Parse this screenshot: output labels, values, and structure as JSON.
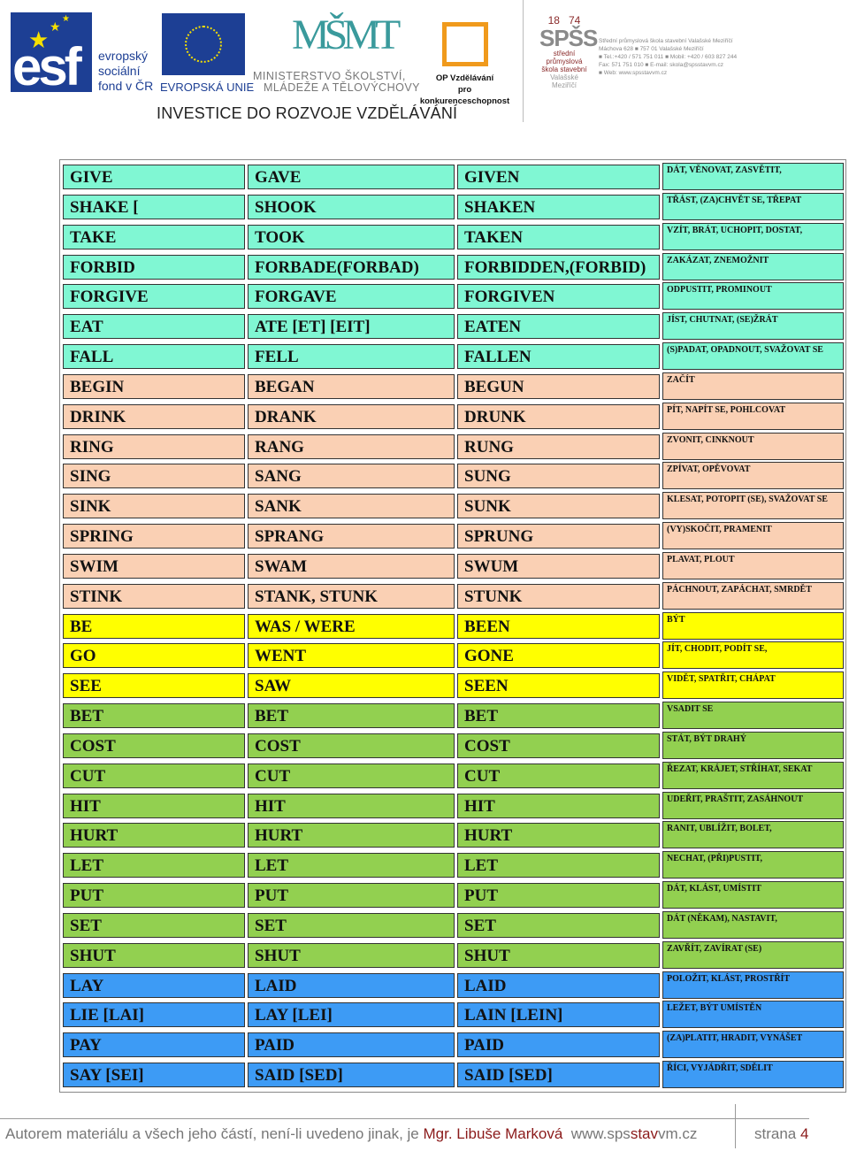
{
  "header": {
    "esf_logo": "esf",
    "esf_label": [
      "evropský",
      "sociální",
      "fond v ČR"
    ],
    "eu_label": "EVROPSKÁ UNIE",
    "msmt_logo": "MŠMT",
    "msmt_label": [
      "MINISTERSTVO ŠKOLSTVÍ,",
      "MLÁDEŽE A TĚLOVÝCHOVY"
    ],
    "op_label": [
      "OP Vzdělávání",
      "pro konkurenceschopnost"
    ],
    "school_logo": {
      "year_left": "18",
      "year_right": "74",
      "abbr": "SPŠS",
      "lines": [
        "střední průmyslová",
        "škola stavební",
        "Valašské Meziříčí"
      ]
    },
    "school_info": [
      "Střední průmyslová škola stavební Valašské Meziříčí",
      "Máchova 628 ■ 757 01 Valašské Meziříčí",
      "■ Tel.:+420 / 571 751 011 ■ Mobil: +420 / 603 827 244",
      "Fax: 571 751 010 ■ E-mail: skola@spsstavvm.cz",
      "■ Web: www.spsstavvm.cz"
    ],
    "slogan": "INVESTICE DO ROZVOJE VZDĚLÁVÁNÍ"
  },
  "colors": {
    "mint": "#80f7d3",
    "peach": "#fad0b4",
    "yellow": "#ffff00",
    "green": "#92d050",
    "blue": "#3d9bf5"
  },
  "rows": [
    {
      "group": "mint",
      "cols": [
        "GIVE",
        "GAVE",
        "GIVEN",
        "DÁT, VĚNOVAT, ZASVĚTIT,"
      ]
    },
    {
      "group": "mint",
      "cols": [
        "SHAKE [",
        "SHOOK",
        "SHAKEN",
        "TŘÁST, (ZA)CHVĚT SE, TŘEPAT"
      ]
    },
    {
      "group": "mint",
      "cols": [
        "TAKE",
        "TOOK",
        "TAKEN",
        "VZÍT, BRÁT, UCHOPIT, DOSTAT,"
      ]
    },
    {
      "group": "mint",
      "cols": [
        "FORBID",
        "FORBADE(FORBAD)",
        "FORBIDDEN,(FORBID)",
        "ZAKÁZAT, ZNEMOŽNIT"
      ]
    },
    {
      "group": "mint",
      "cols": [
        "FORGIVE",
        "FORGAVE",
        "FORGIVEN",
        "ODPUSTIT, PROMINOUT"
      ]
    },
    {
      "group": "mint",
      "cols": [
        "EAT",
        "ATE [ET] [EIT]",
        "EATEN",
        "JÍST, CHUTNAT, (SE)ŽRÁT"
      ]
    },
    {
      "group": "mint",
      "cols": [
        "FALL",
        "FELL",
        "FALLEN",
        "(S)PADAT, OPADNOUT, SVAŽOVAT SE"
      ]
    },
    {
      "group": "peach",
      "cols": [
        "BEGIN",
        "BEGAN",
        "BEGUN",
        "ZAČÍT"
      ]
    },
    {
      "group": "peach",
      "cols": [
        "DRINK",
        "DRANK",
        "DRUNK",
        "PÍT, NAPÍT SE, POHLCOVAT"
      ]
    },
    {
      "group": "peach",
      "cols": [
        "RING",
        "RANG",
        "RUNG",
        "ZVONIT, CINKNOUT"
      ]
    },
    {
      "group": "peach",
      "cols": [
        "SING",
        "SANG",
        "SUNG",
        "ZPÍVAT, OPĚVOVAT"
      ]
    },
    {
      "group": "peach",
      "cols": [
        "SINK",
        "SANK",
        "SUNK",
        "KLESAT, POTOPIT (SE), SVAŽOVAT SE"
      ]
    },
    {
      "group": "peach",
      "cols": [
        "SPRING",
        "SPRANG",
        "SPRUNG",
        "(VY)SKOČIT, PRAMENIT"
      ]
    },
    {
      "group": "peach",
      "cols": [
        "SWIM",
        "SWAM",
        "SWUM",
        "PLAVAT, PLOUT"
      ]
    },
    {
      "group": "peach",
      "cols": [
        "STINK",
        "STANK, STUNK",
        "STUNK",
        "PÁCHNOUT, ZAPÁCHAT, SMRDĚT"
      ]
    },
    {
      "group": "yellow",
      "cols": [
        "BE",
        "WAS / WERE",
        "BEEN",
        "BÝT"
      ]
    },
    {
      "group": "yellow",
      "cols": [
        "GO",
        "WENT",
        "GONE",
        "JÍT, CHODIT, PODÍT SE,"
      ]
    },
    {
      "group": "yellow",
      "cols": [
        "SEE",
        "SAW",
        "SEEN",
        "VIDĚT, SPATŘIT, CHÁPAT"
      ]
    },
    {
      "group": "green",
      "cols": [
        "BET",
        "BET",
        "BET",
        "VSADIT SE"
      ]
    },
    {
      "group": "green",
      "cols": [
        "COST",
        "COST",
        "COST",
        "STÁT, BÝT DRAHÝ"
      ]
    },
    {
      "group": "green",
      "cols": [
        "CUT",
        "CUT",
        "CUT",
        "ŘEZAT, KRÁJET, STŘÍHAT, SEKAT"
      ]
    },
    {
      "group": "green",
      "cols": [
        "HIT",
        "HIT",
        "HIT",
        "UDEŘIT, PRAŠTIT, ZASÁHNOUT"
      ]
    },
    {
      "group": "green",
      "cols": [
        "HURT",
        "HURT",
        "HURT",
        "RANIT, UBLÍŽIT, BOLET,"
      ]
    },
    {
      "group": "green",
      "cols": [
        "LET",
        "LET",
        "LET",
        "NECHAT, (PŘI)PUSTIT,"
      ]
    },
    {
      "group": "green",
      "cols": [
        "PUT",
        "PUT",
        "PUT",
        "DÁT, KLÁST, UMÍSTIT"
      ]
    },
    {
      "group": "green",
      "cols": [
        "SET",
        "SET",
        "SET",
        "DÁT (NĚKAM), NASTAVIT,"
      ]
    },
    {
      "group": "green",
      "cols": [
        "SHUT",
        "SHUT",
        "SHUT",
        "ZAVŘÍT, ZAVÍRAT (SE)"
      ]
    },
    {
      "group": "blue",
      "cols": [
        "LAY",
        "LAID",
        "LAID",
        "POLOŽIT, KLÁST, PROSTŘÍT"
      ]
    },
    {
      "group": "blue",
      "cols": [
        "LIE [LAI]",
        "LAY [LEI]",
        "LAIN [LEIN]",
        "LEŽET, BÝT UMÍSTĚN"
      ]
    },
    {
      "group": "blue",
      "cols": [
        "PAY",
        "PAID",
        "PAID",
        "(ZA)PLATIT, HRADIT, VYNÁŠET"
      ]
    },
    {
      "group": "blue",
      "cols": [
        "SAY [SEI]",
        "SAID [SED]",
        "SAID [SED]",
        "ŘÍCI, VYJÁDŘIT, SDĚLIT"
      ]
    }
  ],
  "footer": {
    "text": "Autorem materiálu a všech jeho částí, není-li uvedeno jinak, je ",
    "author": "Mgr. Libuše Marková",
    "web_pre": "  www.sps",
    "web_mid": "stav",
    "web_post": "vm.cz",
    "page_label": "strana ",
    "page_number": "4"
  }
}
